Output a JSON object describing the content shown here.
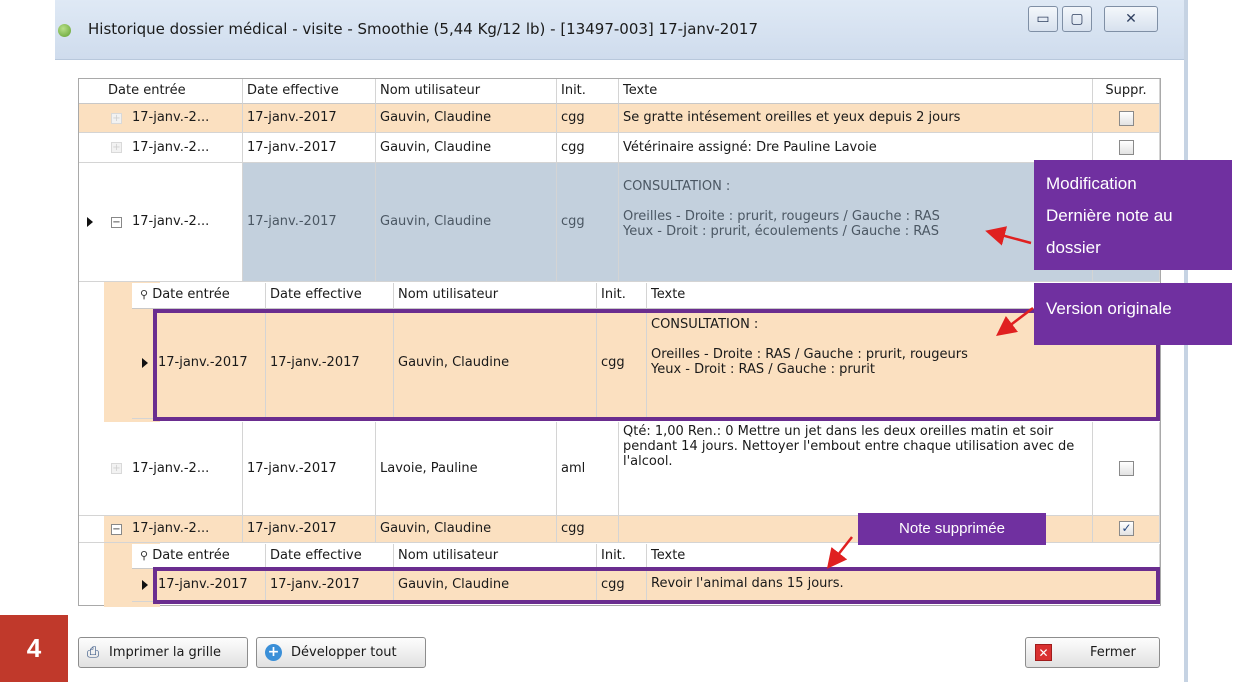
{
  "window": {
    "title": "Historique dossier médical - visite - Smoothie (5,44 Kg/12 lb) - [13497-003] 17-janv-2017",
    "controls": [
      "▭",
      "▢",
      "✕"
    ]
  },
  "grid": {
    "columns": [
      "Date entrée",
      "Date effective",
      "Nom utilisateur",
      "Init.",
      "Texte",
      "Suppr."
    ],
    "rows": [
      {
        "date_entree": "17-janv.-2...",
        "date_effective": "17-janv.-2017",
        "utilisateur": "Gauvin, Claudine",
        "init": "cgg",
        "texte": "Se gratte intésement oreilles et yeux depuis 2 jours",
        "suppr": false
      },
      {
        "date_entree": "17-janv.-2...",
        "date_effective": "17-janv.-2017",
        "utilisateur": "Gauvin, Claudine",
        "init": "cgg",
        "texte": "Vétérinaire assigné: Dre Pauline Lavoie",
        "suppr": false
      },
      {
        "date_entree": "17-janv.-2...",
        "date_effective": "17-janv.-2017",
        "utilisateur": "Gauvin, Claudine",
        "init": "cgg",
        "texte_lines": [
          "CONSULTATION :",
          "",
          "Oreilles - Droite : prurit, rougeurs  / Gauche : RAS",
          "Yeux - Droit : prurit, écoulements / Gauche : RAS"
        ],
        "suppr": false
      },
      {
        "date_entree": "17-janv.-2...",
        "date_effective": "17-janv.-2017",
        "utilisateur": "Lavoie, Pauline",
        "init": "aml",
        "texte": "Qté: 1,00 Ren.: 0 Mettre un jet dans les deux oreilles matin et soir pendant 14 jours. Nettoyer l'embout entre chaque utilisation  avec de l'alcool.",
        "suppr": false
      },
      {
        "date_entree": "17-janv.-2...",
        "date_effective": "17-janv.-2017",
        "utilisateur": "Gauvin, Claudine",
        "init": "cgg",
        "texte": "",
        "suppr": true
      }
    ],
    "sub_columns": [
      "Date entrée",
      "Date effective",
      "Nom utilisateur",
      "Init.",
      "Texte"
    ],
    "sub_original": {
      "date_entree": "17-janv.-2017",
      "date_effective": "17-janv.-2017",
      "utilisateur": "Gauvin, Claudine",
      "init": "cgg",
      "texte_lines": [
        "CONSULTATION :",
        "",
        "Oreilles - Droite : RAS / Gauche : prurit, rougeurs",
        "Yeux - Droit : RAS / Gauche : prurit"
      ]
    },
    "sub_deleted": {
      "date_entree": "17-janv.-2017",
      "date_effective": "17-janv.-2017",
      "utilisateur": "Gauvin, Claudine",
      "init": "cgg",
      "texte": "Revoir l'animal dans 15 jours."
    }
  },
  "callouts": {
    "modification_lines": [
      "Modification",
      "Dernière note au",
      "dossier"
    ],
    "original": "Version originale",
    "deleted": "Note supprimée",
    "color": "#7030a0"
  },
  "buttons": {
    "print": "Imprimer la grille",
    "expand": "Développer tout",
    "close": "Fermer"
  },
  "step_badge": "4"
}
